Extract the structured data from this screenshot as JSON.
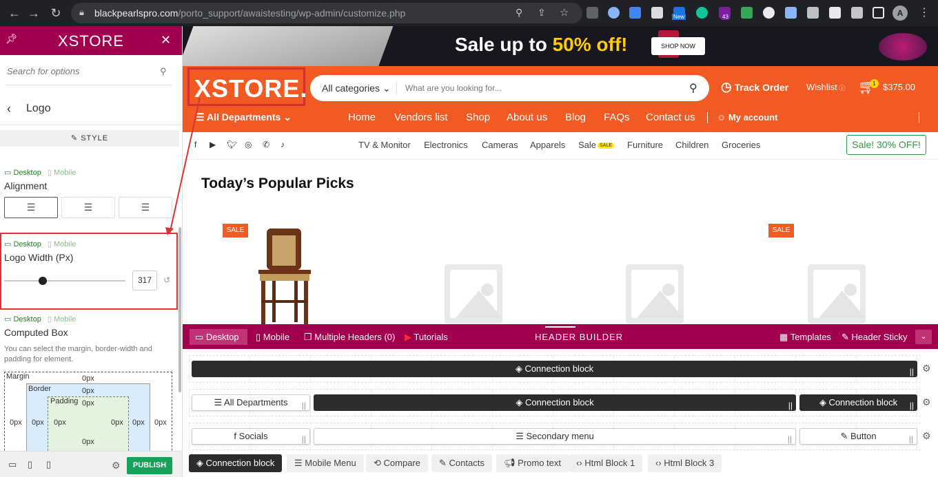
{
  "browser": {
    "url_host": "blackpearlspro.com",
    "url_path": "/porto_support/awaistesting/wp-admin/customize.php",
    "profile_initial": "A",
    "ext_badge_new": "New",
    "ext_badge_count": "43"
  },
  "sidebar": {
    "brand": "XSTORE",
    "search_placeholder": "Search for options",
    "section_title": "Logo",
    "style_tab": "STYLE",
    "device_desktop": "Desktop",
    "device_mobile": "Mobile",
    "alignment_label": "Alignment",
    "logo_width_label": "Logo Width (Px)",
    "logo_width_value": "317",
    "logo_width_fraction": 0.32,
    "computed_box_label": "Computed Box",
    "computed_box_desc": "You can select the margin, border-width and padding for element.",
    "box": {
      "margin": "Margin",
      "border": "Border",
      "padding": "Padding",
      "value": "0px"
    },
    "publish": "PUBLISH"
  },
  "site": {
    "banner_prefix": "Sale up to ",
    "banner_highlight": "50% off!",
    "shop_now": "SHOP NOW",
    "logo": "XSTORE.",
    "search_category": "All categories",
    "search_placeholder": "What are you looking for...",
    "track_order": "Track Order",
    "wishlist": "Wishlist",
    "cart_count": "1",
    "cart_total": "$375.00",
    "all_departments": "All Departments",
    "nav": [
      "Home",
      "Vendors list",
      "Shop",
      "About us",
      "Blog",
      "FAQs",
      "Contact us"
    ],
    "my_account": "My account",
    "categories": [
      "TV & Monitor",
      "Electronics",
      "Cameras",
      "Apparels",
      "Sale",
      "Furniture",
      "Children",
      "Groceries"
    ],
    "sale_badge": "SALE",
    "promo_button": "Sale! 30% OFF!",
    "section_heading": "Today’s Popular Picks",
    "sale_tag": "SALE"
  },
  "builder": {
    "tabs": [
      "Desktop",
      "Mobile",
      "Multiple Headers (0)",
      "Tutorials"
    ],
    "title": "HEADER BUILDER",
    "templates": "Templates",
    "header_sticky": "Header Sticky",
    "row1": [
      "Connection block"
    ],
    "row2": [
      "All Departments",
      "Connection block",
      "Connection block"
    ],
    "row3": [
      "Socials",
      "Secondary menu",
      "Button"
    ],
    "available": [
      "Connection block",
      "Mobile Menu",
      "Compare",
      "Contacts",
      "Promo text",
      "Html Block 1",
      "Html Block 3"
    ]
  },
  "colors": {
    "brand_magenta": "#a2004f",
    "site_orange": "#f15a22",
    "publish_green": "#18a15b",
    "highlight_red": "#e03030"
  }
}
